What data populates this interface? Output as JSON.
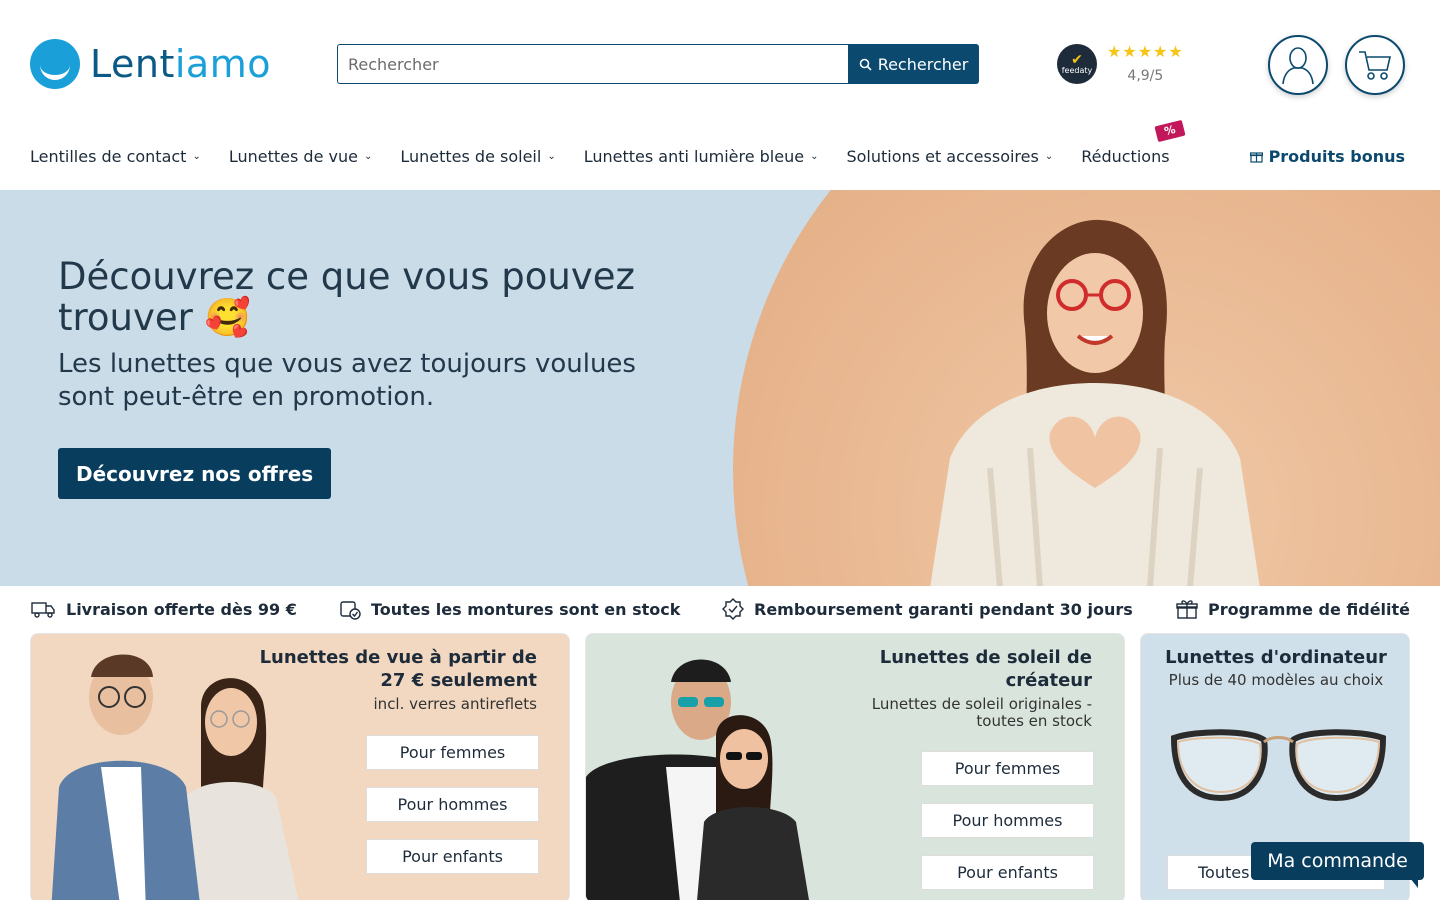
{
  "brand": {
    "name_a": "Lent",
    "name_b": "iamo"
  },
  "search": {
    "placeholder": "Rechercher",
    "button_label": "Rechercher"
  },
  "rating": {
    "badge": "feedaty",
    "stars": "★★★★★",
    "score": "4,9/5"
  },
  "nav": {
    "items": [
      {
        "label": "Lentilles de contact",
        "chevron": "⌄"
      },
      {
        "label": "Lunettes de vue",
        "chevron": "⌄"
      },
      {
        "label": "Lunettes de soleil",
        "chevron": "⌄"
      },
      {
        "label": "Lunettes anti lumière bleue",
        "chevron": "⌄"
      },
      {
        "label": "Solutions et accessoires",
        "chevron": "⌄"
      }
    ],
    "reductions": "Réductions",
    "reductions_tag": "%",
    "bonus": "Produits bonus"
  },
  "hero": {
    "title": "Découvrez ce que vous pouvez trouver 🥰",
    "subtitle": "Les lunettes que vous avez toujours voulues sont peut-être en promotion.",
    "cta": "Découvrez nos offres"
  },
  "benefits": [
    "Livraison offerte dès 99 €",
    "Toutes les montures sont en stock",
    "Remboursement garanti pendant 30 jours",
    "Programme de fidélité"
  ],
  "cards": {
    "vue": {
      "title": "Lunettes de vue à partir de 27 € seulement",
      "subtitle": "incl. verres antireflets",
      "buttons": [
        "Pour femmes",
        "Pour hommes",
        "Pour enfants"
      ]
    },
    "soleil": {
      "title": "Lunettes de soleil de créateur",
      "subtitle": "Lunettes de soleil originales - toutes en stock",
      "buttons": [
        "Pour femmes",
        "Pour hommes",
        "Pour enfants"
      ]
    },
    "ordinateur": {
      "title": "Lunettes d'ordinateur",
      "subtitle": "Plus de 40 modèles au choix",
      "button": "Toutes"
    }
  },
  "chat": {
    "label": "Ma commande"
  },
  "colors": {
    "primary": "#0b4a6e",
    "brand_light": "#1a9fd9",
    "hero_bg": "#c9dce7",
    "star": "#f5c518"
  }
}
